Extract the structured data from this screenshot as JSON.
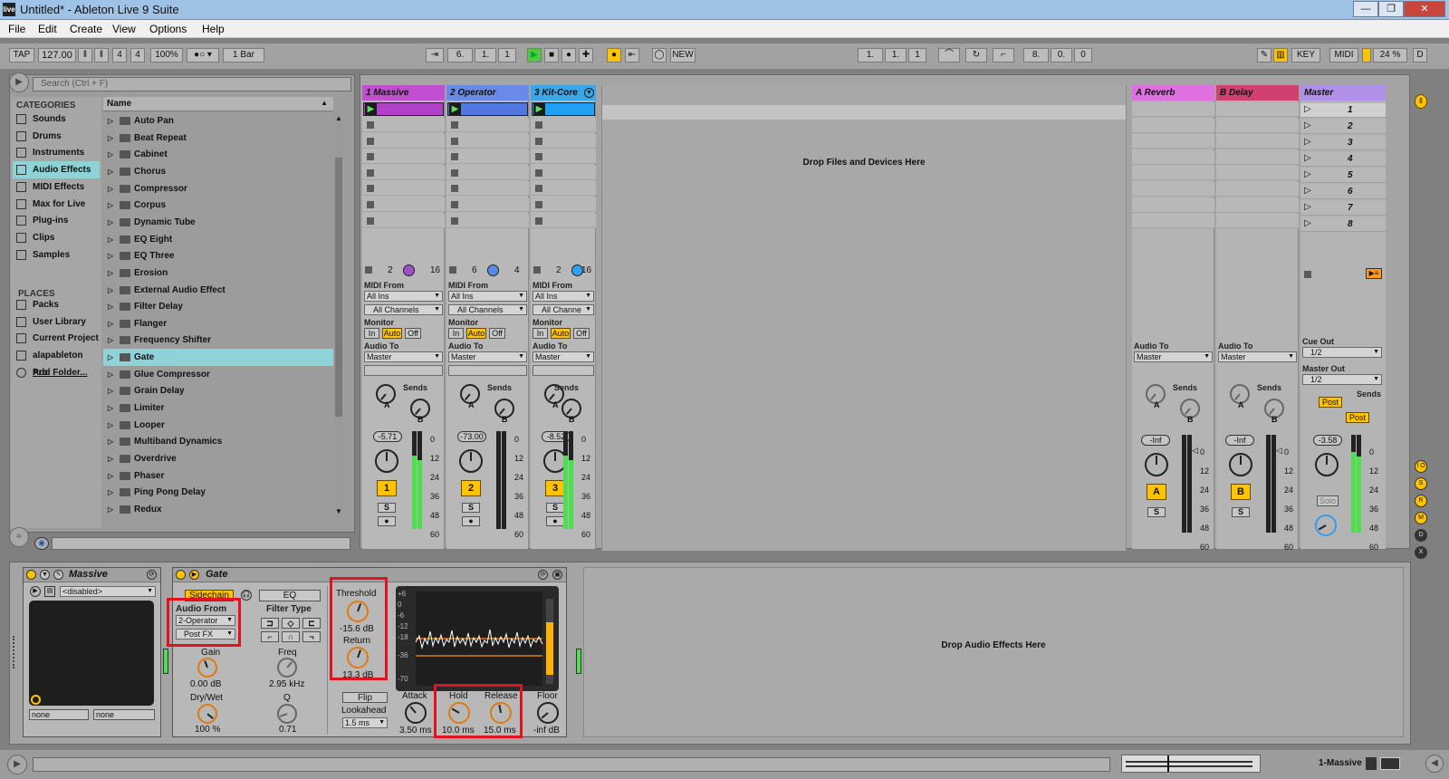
{
  "window": {
    "title": "Untitled* - Ableton Live 9 Suite",
    "logo": "live",
    "controls": [
      "—",
      "❐",
      "✕"
    ]
  },
  "menu": [
    "File",
    "Edit",
    "Create",
    "View",
    "Options",
    "Help"
  ],
  "transport": {
    "tap": "TAP",
    "tempo": "127.00",
    "sig_num": "4",
    "sig_den": "4",
    "zoom": "100%",
    "quant": "1 Bar",
    "pos": [
      "6.",
      "1.",
      "1"
    ],
    "new": "NEW",
    "loop_start": [
      "1.",
      "1.",
      "1"
    ],
    "loop_len": [
      "8.",
      "0.",
      "0"
    ],
    "key": "KEY",
    "midi": "MIDI",
    "cpu": "24 %",
    "d": "D"
  },
  "browser": {
    "search_placeholder": "Search (Ctrl + F)",
    "categories_title": "CATEGORIES",
    "categories": [
      "Sounds",
      "Drums",
      "Instruments",
      "Audio Effects",
      "MIDI Effects",
      "Max for Live",
      "Plug-ins",
      "Clips",
      "Samples"
    ],
    "places_title": "PLACES",
    "places": [
      "Packs",
      "User Library",
      "Current Project",
      "alapableton Pro",
      "Add Folder..."
    ],
    "name_header": "Name",
    "items": [
      "Auto Pan",
      "Beat Repeat",
      "Cabinet",
      "Chorus",
      "Compressor",
      "Corpus",
      "Dynamic Tube",
      "EQ Eight",
      "EQ Three",
      "Erosion",
      "External Audio Effect",
      "Filter Delay",
      "Flanger",
      "Frequency Shifter",
      "Gate",
      "Glue Compressor",
      "Grain Delay",
      "Limiter",
      "Looper",
      "Multiband Dynamics",
      "Overdrive",
      "Phaser",
      "Ping Pong Delay",
      "Redux"
    ]
  },
  "tracks": [
    {
      "name": "1 Massive",
      "color": "#c050d0",
      "clip": "#b040c8",
      "io1": "2",
      "io2": "16",
      "vol": "-5.71",
      "num": "1",
      "knob": "#9b4fc8"
    },
    {
      "name": "2 Operator",
      "color": "#6a8ae8",
      "clip": "#5078e0",
      "io1": "6",
      "io2": "4",
      "vol": "-73.00",
      "num": "2",
      "knob": "#5a8ae8"
    },
    {
      "name": "3 Kit-Core",
      "color": "#3aa8e8",
      "clip": "#20a0f0",
      "io1": "2",
      "io2": "16",
      "vol": "-8.52",
      "num": "3",
      "knob": "#30a0f0"
    }
  ],
  "returns": [
    {
      "name": "A Reverb",
      "color": "#e070e0",
      "vol": "-Inf",
      "letter": "A"
    },
    {
      "name": "B Delay",
      "color": "#d04070",
      "vol": "-Inf",
      "letter": "B"
    }
  ],
  "master": {
    "name": "Master",
    "color": "#b090e8",
    "scenes": [
      "1",
      "2",
      "3",
      "4",
      "5",
      "6",
      "7",
      "8"
    ],
    "vol": "-3.58",
    "cue_out_label": "Cue Out",
    "cue_out": "1/2",
    "master_out_label": "Master Out",
    "master_out": "1/2",
    "post": "Post",
    "solo": "Solo"
  },
  "drop_files": "Drop Files and Devices Here",
  "io": {
    "midi_from": "MIDI From",
    "all_ins": "All Ins",
    "all_channels": "All Channels",
    "all_channels_short": "All Channe",
    "monitor": "Monitor",
    "in": "In",
    "auto": "Auto",
    "off": "Off",
    "audio_to": "Audio To",
    "master": "Master",
    "sends": "Sends",
    "a": "A",
    "b": "B",
    "s": "S"
  },
  "meter_scale": [
    "0",
    "12",
    "24",
    "36",
    "48",
    "60"
  ],
  "devices": {
    "massive": {
      "title": "Massive",
      "disabled": "<disabled>",
      "none1": "none",
      "none2": "none"
    },
    "gate": {
      "title": "Gate",
      "sidechain": "Sidechain",
      "eq": "EQ",
      "audio_from": "Audio From",
      "src": "2-Operator",
      "post_fx": "Post FX",
      "filter_type": "Filter Type",
      "gain": "Gain",
      "gain_val": "0.00 dB",
      "freq": "Freq",
      "freq_val": "2.95 kHz",
      "drywet": "Dry/Wet",
      "drywet_val": "100 %",
      "q": "Q",
      "q_val": "0.71",
      "threshold": "Threshold",
      "threshold_val": "-15.6 dB",
      "return": "Return",
      "return_val": "13.3 dB",
      "flip": "Flip",
      "lookahead": "Lookahead",
      "lookahead_val": "1.5 ms",
      "attack": "Attack",
      "attack_val": "3.50 ms",
      "hold": "Hold",
      "hold_val": "10.0 ms",
      "release": "Release",
      "release_val": "15.0 ms",
      "floor": "Floor",
      "floor_val": "-inf dB",
      "db_scale": [
        "+6",
        "0",
        "-6",
        "-12",
        "-18",
        "-36",
        "-70"
      ]
    },
    "drop_effects": "Drop Audio Effects Here"
  },
  "status": {
    "track": "1-Massive"
  },
  "side_letters": [
    "I O",
    "S",
    "R",
    "M",
    "D",
    "X"
  ]
}
